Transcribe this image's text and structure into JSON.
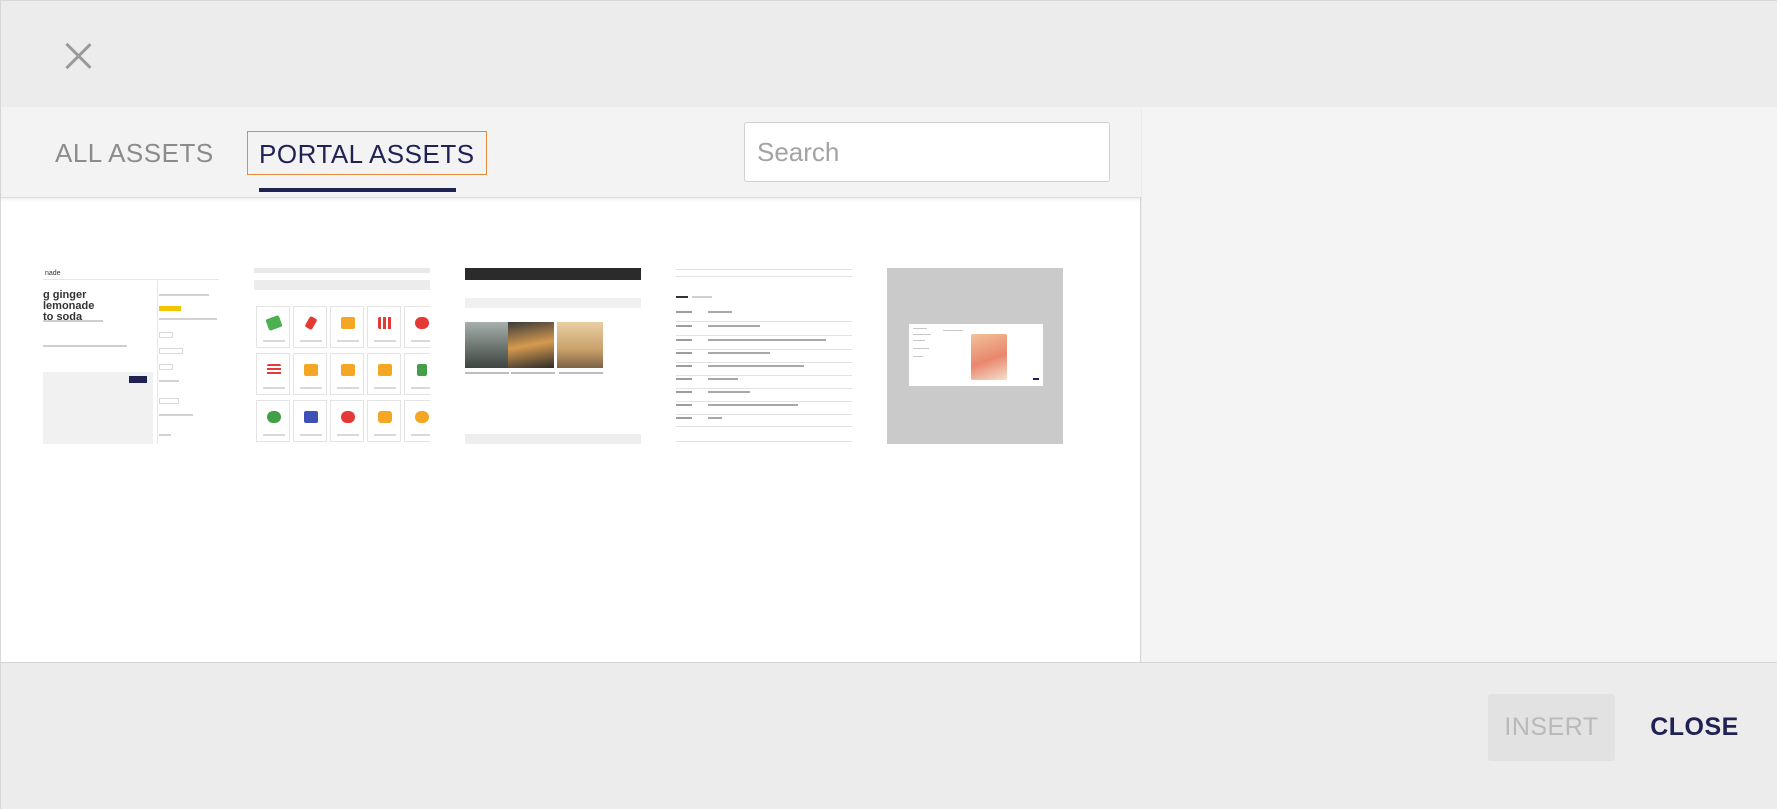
{
  "dialog": {
    "close_icon": "close-x-icon"
  },
  "tabs": [
    {
      "label": "ALL ASSETS",
      "active": false
    },
    {
      "label": "PORTAL ASSETS",
      "active": true
    }
  ],
  "search": {
    "placeholder": "Search",
    "value": ""
  },
  "thumbnails": [
    {
      "kind": "article-page",
      "header": "nade",
      "title": "g ginger lemonade\nto soda"
    },
    {
      "kind": "icon-grid"
    },
    {
      "kind": "photo-gallery"
    },
    {
      "kind": "file-types-table"
    },
    {
      "kind": "screen-preview"
    }
  ],
  "footer": {
    "insert_label": "INSERT",
    "close_label": "CLOSE"
  },
  "colors": {
    "accent": "#1f2253",
    "focus_outline": "#e38a3c",
    "disabled_text": "#b9b9b9"
  }
}
